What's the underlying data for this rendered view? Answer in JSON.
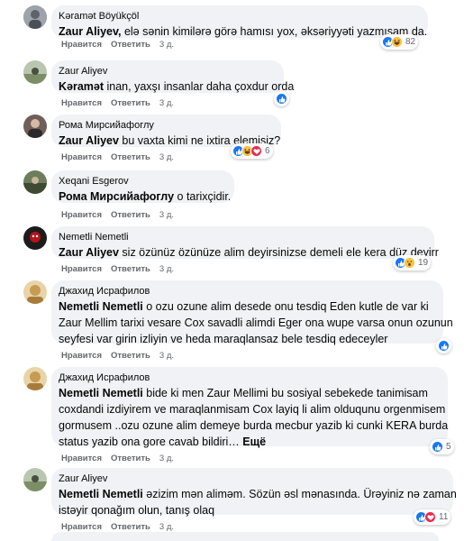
{
  "action_labels": {
    "like": "Нравится",
    "reply": "Ответить"
  },
  "comments": [
    {
      "author": "Kəramət Böyükçöl",
      "mention": "Zaur Aliyev,",
      "text": " elə sənin kimilərə görə hamısı yox, əksəriyyəti yazmışam da.",
      "time": "3 д.",
      "reaction_count": "82",
      "reactions": [
        "like-reaction-icon",
        "haha-reaction-icon"
      ]
    },
    {
      "author": "Zaur Aliyev",
      "mention": "Kəramət",
      "text": " inan, yaxşı insanlar daha çoxdur orda",
      "time": "3 д.",
      "reaction_count": "",
      "reactions": [
        "like-reaction-icon"
      ]
    },
    {
      "author": "Рома Мирсийафоглу",
      "mention": "Zaur Aliyev",
      "text": " bu vaxta kimi ne ixtira elemisiz?",
      "time": "3 д.",
      "reaction_count": "6",
      "reactions": [
        "like-reaction-icon",
        "haha-reaction-icon",
        "love-reaction-icon"
      ]
    },
    {
      "author": "Xeqani Esgerov",
      "mention": "Рома Мирсийафоглу",
      "text": " o tarixçidir.",
      "time": "3 д.",
      "reaction_count": "",
      "reactions": []
    },
    {
      "author": "Nemetli Nemetli",
      "mention": "Zaur Aliyev",
      "text": " siz özünüz özünüze alim deyirsinizse demeli ele kera düz deyirr",
      "time": "3 д.",
      "reaction_count": "19",
      "reactions": [
        "like-reaction-icon",
        "wow-reaction-icon"
      ]
    },
    {
      "author": "Джахид Исрафилов",
      "mention": "Nemetli Nemetli",
      "text_lines": [
        " o ozu ozune alim desede onu tesdiq Eden kutle de var ki",
        "Zaur Mellim tarixi vesare Cox savadli alimdi Eger ona wupe varsa onun ozunun",
        "seyfesi var girin izliyin ve heda maraqlansaz bele tesdiq edeceyler"
      ],
      "time": "3 д.",
      "reaction_count": "",
      "reactions": [
        "like-reaction-icon"
      ]
    },
    {
      "author": "Джахид Исрафилов",
      "mention": "Nemetli Nemetli",
      "text_lines": [
        " bide ki men Zaur Mellimi bu sosiyal sebekede tanimisam",
        "coxdandi izdiyirem ve maraqlanmisam Cox layiq li alim olduqunu orgenmisem",
        "gormusem ..ozu ozune alim demeye burda mecbur yazib ki cunki KERA burda",
        "status yazib ona gore cavab bildiri…"
      ],
      "more": " Ещё",
      "time": "3 д.",
      "reaction_count": "5",
      "reactions": [
        "like-reaction-icon"
      ]
    },
    {
      "author": "Zaur Aliyev",
      "mention": "Nemetli Nemetli",
      "text_lines": [
        " əzizim mən aliməm. Sözün əsl mənasında. Ürəyiniz nə zaman",
        "istəyir qonağım olun, tanış olaq"
      ],
      "time": "3 д.",
      "reaction_count": "11",
      "reactions": [
        "like-reaction-icon",
        "love-reaction-icon"
      ]
    }
  ],
  "colors": {
    "bubble": "#f0f2f5",
    "like": "#1877f2",
    "love": "#f02849",
    "haha": "#f7c444",
    "meta": "#65676b"
  }
}
